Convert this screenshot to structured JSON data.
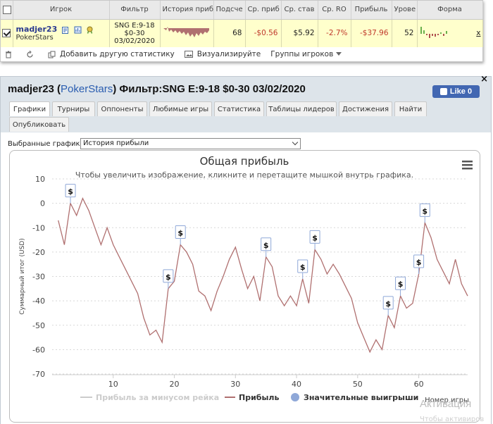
{
  "stats": {
    "headers": [
      "Игрок",
      "Фильтр",
      "История приб",
      "Подсче",
      "Ср. приб",
      "Ср. став",
      "Ср. RO",
      "Прибыль",
      "Урове",
      "Форма"
    ],
    "row": {
      "player": "madjer23",
      "site": "PokerStars",
      "filter_line1": "SNG E:9-18",
      "filter_line2": "$0-30",
      "filter_line3": "03/02/2020",
      "count": "68",
      "avg_profit": "-$0.56",
      "avg_stake": "$5.92",
      "avg_roi": "-2.7%",
      "profit": "-$37.96",
      "level": "52",
      "remove": "x"
    }
  },
  "toolbar": {
    "add_stats": "Добавить другую статистику",
    "visualize": "Визуализируйте",
    "groups": "Группы игроков"
  },
  "panel": {
    "close": "×",
    "player": "madjer23",
    "site_open": "(",
    "site": "PokerStars",
    "site_close": ")",
    "filter": "Фильтр:SNG E:9-18 $0-30 03/02/2020",
    "like": "Like 0",
    "tabs": [
      "Графики",
      "Турниры",
      "Оппоненты",
      "Любимые игры",
      "Статистика",
      "Таблицы лидеров",
      "Достижения",
      "Найти",
      "Опубликовать"
    ],
    "selected_charts_label": "Выбранные графики:",
    "selected_chart_value": "История прибыли"
  },
  "chart_data": {
    "type": "line",
    "title": "Общая прибыль",
    "subtitle": "Чтобы увеличить изображение, кликните и перетащите мышкой внутрь графика.",
    "ylabel": "Суммарный итог (USD)",
    "xlabel": "Номер игры",
    "ylim": [
      -70,
      10
    ],
    "yticks": [
      10,
      0,
      -10,
      -20,
      -30,
      -40,
      -50,
      -60,
      -70
    ],
    "xlim": [
      0,
      68
    ],
    "xticks": [
      10,
      20,
      30,
      40,
      50,
      60
    ],
    "grid": true,
    "series": [
      {
        "name": "Прибыль",
        "color": "#b07070",
        "x": [
          1,
          2,
          3,
          4,
          5,
          6,
          7,
          8,
          9,
          10,
          11,
          12,
          13,
          14,
          15,
          16,
          17,
          18,
          19,
          20,
          21,
          22,
          23,
          24,
          25,
          26,
          27,
          28,
          29,
          30,
          31,
          32,
          33,
          34,
          35,
          36,
          37,
          38,
          39,
          40,
          41,
          42,
          43,
          44,
          45,
          46,
          47,
          48,
          49,
          50,
          51,
          52,
          53,
          54,
          55,
          56,
          57,
          58,
          59,
          60,
          61,
          62,
          63,
          64,
          65,
          66,
          67,
          68
        ],
        "values": [
          -7,
          -17,
          0,
          -5,
          2,
          -3,
          -10,
          -17,
          -10,
          -17,
          -22,
          -27,
          -32,
          -37,
          -47,
          -54,
          -52,
          -57,
          -35,
          -32,
          -17,
          -20,
          -25,
          -36,
          -38,
          -44,
          -36,
          -30,
          -23,
          -18,
          -27,
          -35,
          -30,
          -40,
          -22,
          -26,
          -38,
          -42,
          -38,
          -42,
          -31,
          -41,
          -19,
          -23,
          -29,
          -25,
          -29,
          -34,
          -39,
          -49,
          -55,
          -61,
          -56,
          -60,
          -46,
          -51,
          -38,
          -43,
          -41,
          -29,
          -8,
          -14,
          -23,
          -28,
          -33,
          -23,
          -33,
          -38
        ]
      },
      {
        "name": "Прибыль за минусом рейка",
        "color": "#cccccc",
        "x": [],
        "values": []
      },
      {
        "name": "Значительные выигрыши",
        "color": "#8fa8d8",
        "x": [
          3,
          19,
          21,
          35,
          41,
          43,
          55,
          57,
          60,
          61
        ],
        "values": [
          0,
          -35,
          -17,
          -22,
          -31,
          -19,
          -46,
          -38,
          -29,
          -8
        ],
        "marker_label": "$"
      }
    ]
  },
  "watermark": {
    "line1": "Активация",
    "line2": "Чтобы активиров"
  }
}
